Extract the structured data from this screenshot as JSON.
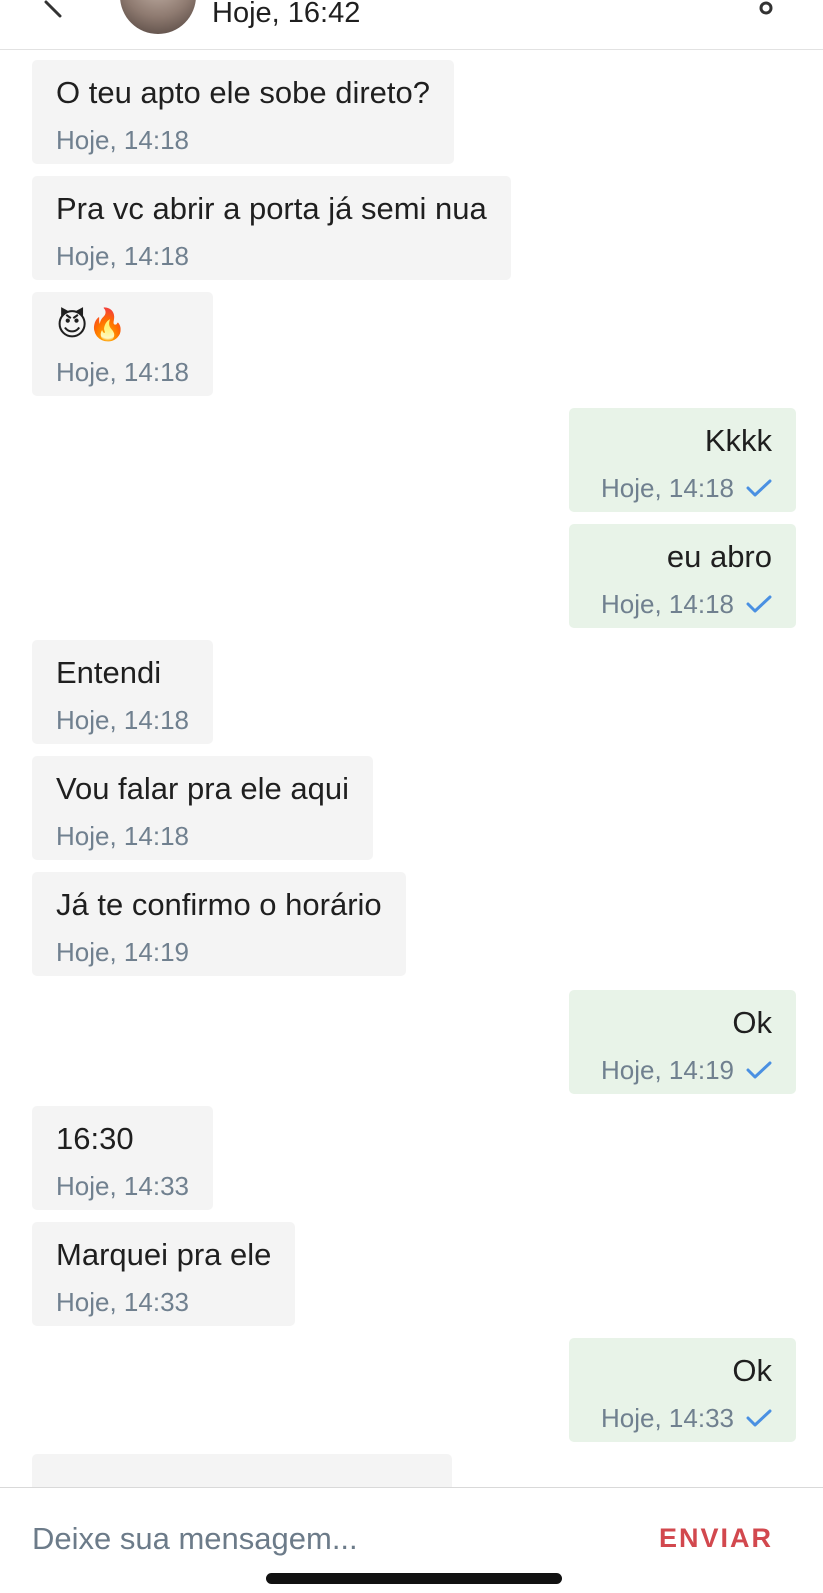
{
  "header": {
    "status": "Hoje, 16:42",
    "back_icon": "chevron-left-icon",
    "menu_icon": "more-vertical-icon"
  },
  "messages": [
    {
      "direction": "in",
      "text": "O teu apto ele sobe direto?",
      "time": "Hoje, 14:18"
    },
    {
      "direction": "in",
      "text": "Pra vc abrir a porta já semi nua",
      "time": "Hoje, 14:18"
    },
    {
      "direction": "in",
      "text": "😈🔥",
      "time": "Hoje, 14:18"
    },
    {
      "direction": "out",
      "text": "Kkkk",
      "time": "Hoje, 14:18",
      "read_icon": "check-icon"
    },
    {
      "direction": "out",
      "text": "eu abro",
      "time": "Hoje, 14:18",
      "read_icon": "check-icon"
    },
    {
      "direction": "in",
      "text": "Entendi",
      "time": "Hoje, 14:18"
    },
    {
      "direction": "in",
      "text": "Vou falar pra ele aqui",
      "time": "Hoje, 14:18"
    },
    {
      "direction": "in",
      "text": "Já te confirmo o horário",
      "time": "Hoje, 14:19"
    },
    {
      "direction": "out",
      "text": "Ok",
      "time": "Hoje, 14:19",
      "read_icon": "check-icon"
    },
    {
      "direction": "in",
      "text": "16:30",
      "time": "Hoje, 14:33"
    },
    {
      "direction": "in",
      "text": "Marquei pra ele",
      "time": "Hoje, 14:33"
    },
    {
      "direction": "out",
      "text": "Ok",
      "time": "Hoje, 14:33",
      "read_icon": "check-icon"
    }
  ],
  "composer": {
    "placeholder": "Deixe sua mensagem...",
    "send_label": "ENVIAR"
  },
  "colors": {
    "incoming_bubble": "#f4f4f4",
    "outgoing_bubble": "#e8f3e8",
    "timestamp": "#70808f",
    "check": "#4a90e2",
    "send_accent": "#d2484e"
  }
}
